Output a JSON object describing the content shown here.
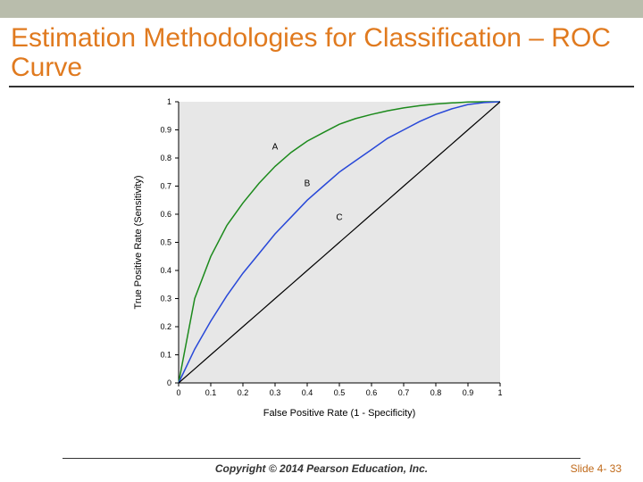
{
  "slide": {
    "title": "Estimation Methodologies for Classification – ROC Curve",
    "copyright": "Copyright © 2014 Pearson Education, Inc.",
    "slide_number": "Slide 4- 33"
  },
  "chart_data": {
    "type": "line",
    "title": "",
    "xlabel": "False Positive Rate (1 - Specificity)",
    "ylabel": "True Positive Rate (Sensitivity)",
    "xlim": [
      0,
      1
    ],
    "ylim": [
      0,
      1
    ],
    "x_ticks": [
      0,
      0.1,
      0.2,
      0.3,
      0.4,
      0.5,
      0.6,
      0.7,
      0.8,
      0.9,
      1
    ],
    "y_ticks": [
      0,
      0.1,
      0.2,
      0.3,
      0.4,
      0.5,
      0.6,
      0.7,
      0.8,
      0.9,
      1
    ],
    "x": [
      0,
      0.05,
      0.1,
      0.15,
      0.2,
      0.25,
      0.3,
      0.35,
      0.4,
      0.45,
      0.5,
      0.55,
      0.6,
      0.65,
      0.7,
      0.75,
      0.8,
      0.85,
      0.9,
      0.95,
      1
    ],
    "series": [
      {
        "name": "A",
        "values": [
          0,
          0.3,
          0.45,
          0.56,
          0.64,
          0.71,
          0.77,
          0.82,
          0.86,
          0.89,
          0.92,
          0.94,
          0.955,
          0.968,
          0.978,
          0.986,
          0.992,
          0.996,
          0.999,
          1.0,
          1.0
        ]
      },
      {
        "name": "B",
        "values": [
          0,
          0.12,
          0.22,
          0.31,
          0.39,
          0.46,
          0.53,
          0.59,
          0.65,
          0.7,
          0.75,
          0.79,
          0.83,
          0.87,
          0.9,
          0.93,
          0.955,
          0.975,
          0.99,
          0.997,
          1.0
        ]
      },
      {
        "name": "C",
        "values": [
          0,
          0.05,
          0.1,
          0.15,
          0.2,
          0.25,
          0.3,
          0.35,
          0.4,
          0.45,
          0.5,
          0.55,
          0.6,
          0.65,
          0.7,
          0.75,
          0.8,
          0.85,
          0.9,
          0.95,
          1.0
        ]
      }
    ],
    "annotations": [
      {
        "label": "A",
        "x": 0.3,
        "y": 0.83
      },
      {
        "label": "B",
        "x": 0.4,
        "y": 0.7
      },
      {
        "label": "C",
        "x": 0.5,
        "y": 0.58
      }
    ]
  }
}
